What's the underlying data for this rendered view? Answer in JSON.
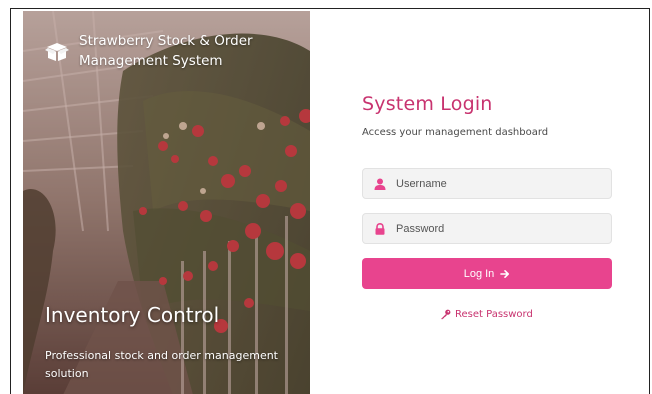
{
  "brand": {
    "title": "Strawberry Stock & Order Management System",
    "logo_icon": "box-open-icon"
  },
  "hero": {
    "heading": "Inventory Control",
    "subtitle": "Professional stock and order management solution"
  },
  "login": {
    "title": "System Login",
    "subtitle": "Access your management dashboard",
    "username_placeholder": "Username",
    "password_placeholder": "Password",
    "submit_label": "Log In",
    "submit_icon": "arrow-right-icon",
    "reset_label": "Reset Password",
    "reset_icon": "key-icon"
  },
  "colors": {
    "accent": "#e8448e",
    "heading": "#c8336f",
    "field_bg": "#f3f3f3"
  }
}
